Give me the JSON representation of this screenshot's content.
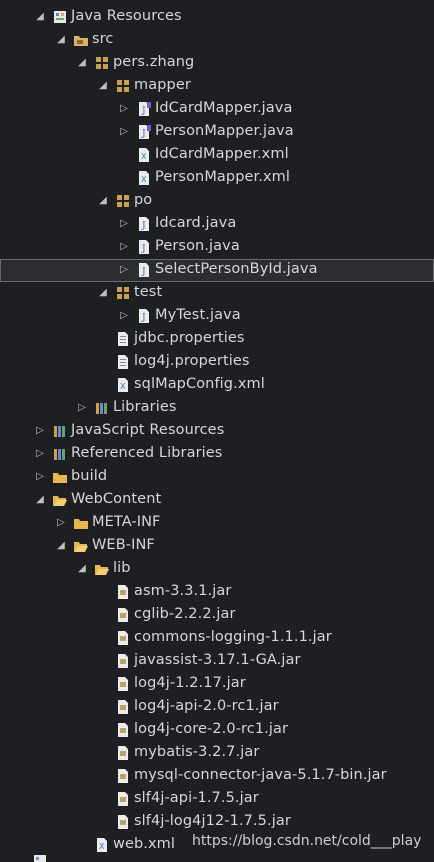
{
  "tree": [
    {
      "label": "Java Resources",
      "depth": 0,
      "expanded": true,
      "icon": "java-resources-icon"
    },
    {
      "label": "src",
      "depth": 1,
      "expanded": true,
      "icon": "source-folder-icon"
    },
    {
      "label": "pers.zhang",
      "depth": 2,
      "expanded": true,
      "icon": "package-icon"
    },
    {
      "label": "mapper",
      "depth": 3,
      "expanded": true,
      "icon": "package-icon"
    },
    {
      "label": "IdCardMapper.java",
      "depth": 4,
      "expanded": false,
      "icon": "java-interface-file-icon"
    },
    {
      "label": "PersonMapper.java",
      "depth": 4,
      "expanded": false,
      "icon": "java-interface-file-icon"
    },
    {
      "label": "IdCardMapper.xml",
      "depth": 4,
      "leaf": true,
      "icon": "xml-file-icon"
    },
    {
      "label": "PersonMapper.xml",
      "depth": 4,
      "leaf": true,
      "icon": "xml-file-icon"
    },
    {
      "label": "po",
      "depth": 3,
      "expanded": true,
      "icon": "package-icon"
    },
    {
      "label": "Idcard.java",
      "depth": 4,
      "expanded": false,
      "icon": "java-file-icon"
    },
    {
      "label": "Person.java",
      "depth": 4,
      "expanded": false,
      "icon": "java-file-icon"
    },
    {
      "label": "SelectPersonById.java",
      "depth": 4,
      "expanded": false,
      "icon": "java-file-icon",
      "selected": true
    },
    {
      "label": "test",
      "depth": 3,
      "expanded": true,
      "icon": "package-icon"
    },
    {
      "label": "MyTest.java",
      "depth": 4,
      "expanded": false,
      "icon": "java-file-icon"
    },
    {
      "label": "jdbc.properties",
      "depth": 3,
      "leaf": true,
      "icon": "properties-file-icon"
    },
    {
      "label": "log4j.properties",
      "depth": 3,
      "leaf": true,
      "icon": "properties-file-icon"
    },
    {
      "label": "sqlMapConfig.xml",
      "depth": 3,
      "leaf": true,
      "icon": "xml-file-icon"
    },
    {
      "label": "Libraries",
      "depth": 2,
      "expanded": false,
      "icon": "library-icon"
    },
    {
      "label": "JavaScript Resources",
      "depth": 0,
      "expanded": false,
      "icon": "library-icon"
    },
    {
      "label": "Referenced Libraries",
      "depth": 0,
      "expanded": false,
      "icon": "library-icon"
    },
    {
      "label": "build",
      "depth": 0,
      "expanded": false,
      "icon": "folder-icon"
    },
    {
      "label": "WebContent",
      "depth": 0,
      "expanded": true,
      "icon": "folder-open-icon"
    },
    {
      "label": "META-INF",
      "depth": 1,
      "expanded": false,
      "icon": "folder-icon"
    },
    {
      "label": "WEB-INF",
      "depth": 1,
      "expanded": true,
      "icon": "folder-open-icon"
    },
    {
      "label": "lib",
      "depth": 2,
      "expanded": true,
      "icon": "folder-open-icon"
    },
    {
      "label": "asm-3.3.1.jar",
      "depth": 3,
      "leaf": true,
      "icon": "jar-file-icon"
    },
    {
      "label": "cglib-2.2.2.jar",
      "depth": 3,
      "leaf": true,
      "icon": "jar-file-icon"
    },
    {
      "label": "commons-logging-1.1.1.jar",
      "depth": 3,
      "leaf": true,
      "icon": "jar-file-icon"
    },
    {
      "label": "javassist-3.17.1-GA.jar",
      "depth": 3,
      "leaf": true,
      "icon": "jar-file-icon"
    },
    {
      "label": "log4j-1.2.17.jar",
      "depth": 3,
      "leaf": true,
      "icon": "jar-file-icon"
    },
    {
      "label": "log4j-api-2.0-rc1.jar",
      "depth": 3,
      "leaf": true,
      "icon": "jar-file-icon"
    },
    {
      "label": "log4j-core-2.0-rc1.jar",
      "depth": 3,
      "leaf": true,
      "icon": "jar-file-icon"
    },
    {
      "label": "mybatis-3.2.7.jar",
      "depth": 3,
      "leaf": true,
      "icon": "jar-file-icon"
    },
    {
      "label": "mysql-connector-java-5.1.7-bin.jar",
      "depth": 3,
      "leaf": true,
      "icon": "jar-file-icon"
    },
    {
      "label": "slf4j-api-1.7.5.jar",
      "depth": 3,
      "leaf": true,
      "icon": "jar-file-icon"
    },
    {
      "label": "slf4j-log4j12-1.7.5.jar",
      "depth": 3,
      "leaf": true,
      "icon": "jar-file-icon"
    },
    {
      "label": "web.xml",
      "depth": 2,
      "leaf": true,
      "icon": "xml-file-icon"
    }
  ],
  "watermark": "https://blog.csdn.net/cold___play",
  "colors": {
    "background": "#1e1f22",
    "text": "#d7d7d7",
    "selection": "#2b2d30"
  }
}
